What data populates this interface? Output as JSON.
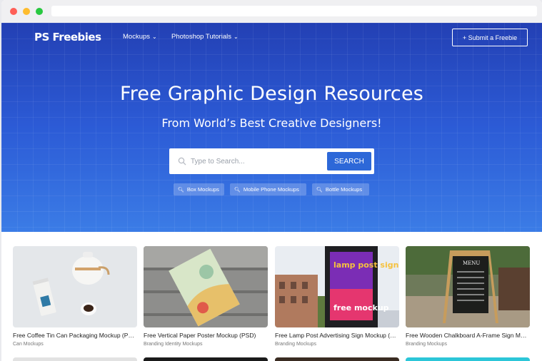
{
  "nav": {
    "logo": "PS Freebies",
    "links": [
      {
        "label": "Mockups",
        "icon": "chevron-down-icon"
      },
      {
        "label": "Photoshop Tutorials",
        "icon": "chevron-down-icon"
      }
    ],
    "submit_label": "+ Submit a Freebie"
  },
  "hero": {
    "title": "Free Graphic Design Resources",
    "subtitle": "From World’s Best Creative Designers!",
    "search": {
      "placeholder": "Type to Search...",
      "button_label": "SEARCH"
    },
    "tags": [
      "Box Mockups",
      "Mobile Phone Mockups",
      "Bottle Mockups"
    ]
  },
  "cards": [
    {
      "title": "Free Coffee Tin Can Packaging Mockup (PSD)",
      "category": "Can Mockups"
    },
    {
      "title": "Free Vertical Paper Poster Mockup (PSD)",
      "category": "Branding Identity Mockups"
    },
    {
      "title": "Free Lamp Post Advertising Sign Mockup (PSD)",
      "category": "Branding Mockups"
    },
    {
      "title": "Free Wooden Chalkboard A-Frame Sign Mockup (PSD)",
      "category": "Branding Mockups"
    }
  ],
  "thumb_text": {
    "lamp_post": "lamp post sign",
    "free_mockup": "free mockup",
    "menu": "MENU"
  },
  "colors": {
    "hero_top": "#2340b4",
    "hero_bottom": "#3b7ce6",
    "search_button": "#2d68d8"
  }
}
